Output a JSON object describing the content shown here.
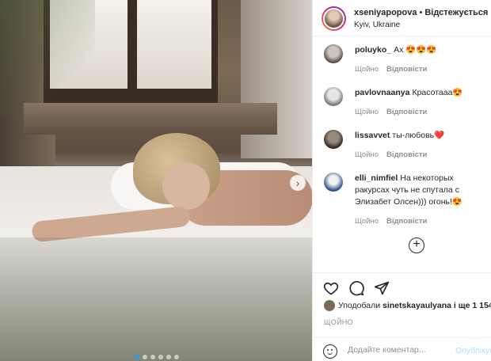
{
  "header": {
    "username": "xseniyapopova",
    "separator": "•",
    "follow_label": "Відстежується",
    "location": "Kyiv, Ukraine"
  },
  "comments": [
    {
      "user": "poluyko_",
      "text": "Ах 😍😍😍",
      "likes": "Щойно",
      "reply": "Відповісти"
    },
    {
      "user": "pavlovnaanya",
      "text": "Красотааа😍",
      "likes": "Щойно",
      "reply": "Відповісти"
    },
    {
      "user": "lissavvet",
      "text": "ты-любовь❤️",
      "likes": "Щойно",
      "reply": "Відповісти"
    },
    {
      "user": "elli_nimfiel",
      "text": "На некоторых ракурсах чуть не спутала с Элизабет Олсен))) огонь!😍",
      "likes": "Щойно",
      "reply": "Відповісти"
    }
  ],
  "load_more_icon": "plus-circle-icon",
  "likes": {
    "prefix": "Уподобали",
    "user": "sinetskayaulyana",
    "suffix": "і ще 1 154"
  },
  "timestamp": "ЩОЙНО",
  "add_comment": {
    "placeholder": "Додайте коментар...",
    "post_label": "Опублікувати"
  },
  "carousel": {
    "dot_count": 6,
    "active_index": 0
  },
  "colors": {
    "post_button": "#b2dffc",
    "carousel_active": "#3897f0",
    "meta_text": "#8e8e8e"
  }
}
